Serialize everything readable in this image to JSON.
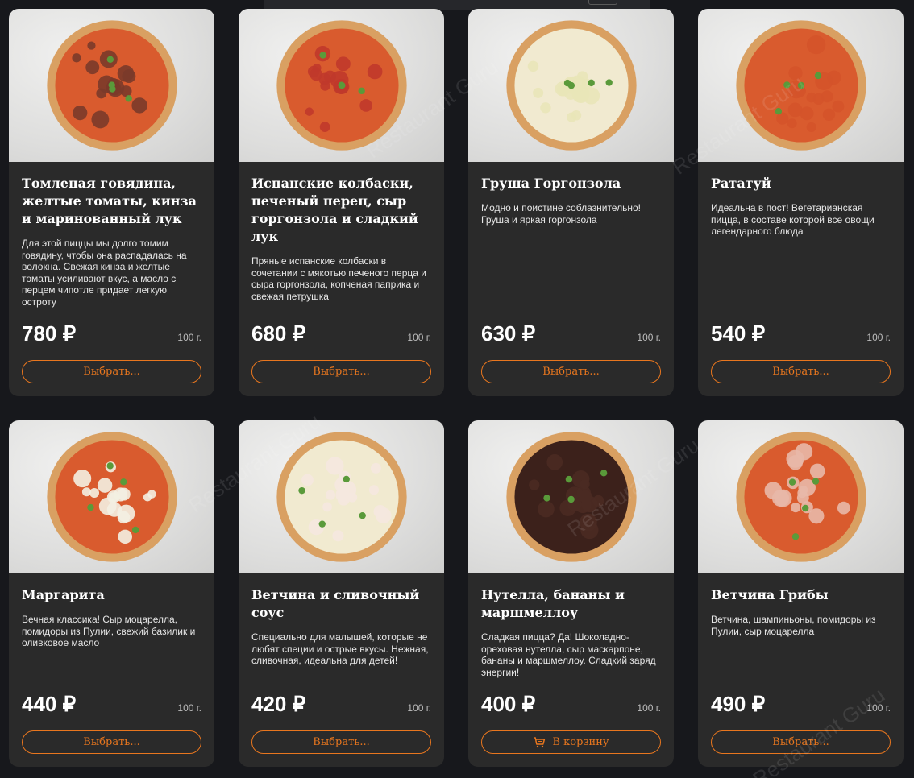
{
  "watermark": "Restaurant Guru",
  "cards": [
    {
      "title": "Томленая говядина, желтые томаты, кинза и маринованный лук",
      "description": "Для этой пиццы мы долго томим говядину, чтобы она распадалась на волокна. Свежая кинза и желтые томаты усиливают вкус, а масло с перцем чипотле придает легкую остроту",
      "price": "780 ₽",
      "weight": "100 г.",
      "button": "Выбрать...",
      "topping": "#7a3a2a"
    },
    {
      "title": "Испанские колбаски, печеный перец, сыр горгонзола и сладкий лук",
      "description": "Пряные испанские колбаски в сочетании с мякотью печеного перца и сыра горгонзола, копченая паприка и свежая петрушка",
      "price": "680 ₽",
      "weight": "100 г.",
      "button": "Выбрать...",
      "topping": "#c0392b"
    },
    {
      "title": "Груша Горгонзола",
      "description": "Модно и поистине соблазнительно! Груша и яркая горгонзола",
      "price": "630 ₽",
      "weight": "100 г.",
      "button": "Выбрать...",
      "topping": "#e9e6b8"
    },
    {
      "title": "Рататуй",
      "description": "Идеальна в пост! Вегетарианская пицца, в составе которой все овощи легендарного блюда",
      "price": "540 ₽",
      "weight": "100 г.",
      "button": "Выбрать...",
      "topping": "#d4532a"
    },
    {
      "title": "Маргарита",
      "description": "Вечная классика! Сыр моцарелла, помидоры из Пулии, свежий базилик и оливковое масло",
      "price": "440 ₽",
      "weight": "100 г.",
      "button": "Выбрать...",
      "topping": "#f3efe2"
    },
    {
      "title": "Ветчина и сливочный соус",
      "description": "Специально для малышей, которые не любят специи и острые вкусы. Нежная, сливочная, идеальна для детей!",
      "price": "420 ₽",
      "weight": "100 г.",
      "button": "Выбрать...",
      "topping": "#f5e8df"
    },
    {
      "title": "Нутелла, бананы и маршмеллоу",
      "description": "Сладкая пицца? Да! Шоколадно-ореховая нутелла, сыр маскарпоне, бананы и маршмеллоу. Сладкий заряд энергии!",
      "price": "400 ₽",
      "weight": "100 г.",
      "button": "В корзину",
      "has_cart_icon": true,
      "topping": "#4a2a22"
    },
    {
      "title": "Ветчина Грибы",
      "description": "Ветчина, шампиньоны, помидоры из Пулии, сыр моцарелла",
      "price": "490 ₽",
      "weight": "100 г.",
      "button": "Выбрать...",
      "topping": "#e8b8a8"
    }
  ]
}
